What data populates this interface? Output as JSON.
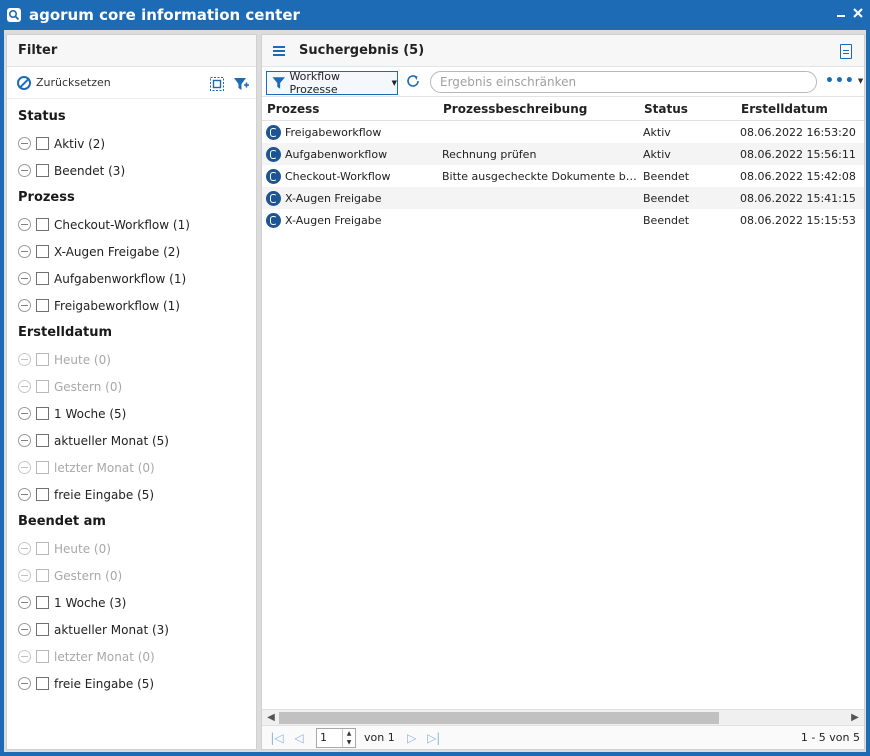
{
  "window": {
    "title": "agorum core information center"
  },
  "filter": {
    "title": "Filter",
    "reset_label": "Zurücksetzen",
    "groups": [
      {
        "title": "Status",
        "items": [
          {
            "label": "Aktiv (2)",
            "enabled": true
          },
          {
            "label": "Beendet (3)",
            "enabled": true
          }
        ]
      },
      {
        "title": "Prozess",
        "items": [
          {
            "label": "Checkout-Workflow (1)",
            "enabled": true
          },
          {
            "label": "X-Augen Freigabe (2)",
            "enabled": true
          },
          {
            "label": "Aufgabenworkflow (1)",
            "enabled": true
          },
          {
            "label": "Freigabeworkflow (1)",
            "enabled": true
          }
        ]
      },
      {
        "title": "Erstelldatum",
        "items": [
          {
            "label": "Heute (0)",
            "enabled": false
          },
          {
            "label": "Gestern (0)",
            "enabled": false
          },
          {
            "label": "1 Woche (5)",
            "enabled": true
          },
          {
            "label": "aktueller Monat (5)",
            "enabled": true
          },
          {
            "label": "letzter Monat (0)",
            "enabled": false
          },
          {
            "label": "freie Eingabe (5)",
            "enabled": true
          }
        ]
      },
      {
        "title": "Beendet am",
        "items": [
          {
            "label": "Heute (0)",
            "enabled": false
          },
          {
            "label": "Gestern (0)",
            "enabled": false
          },
          {
            "label": "1 Woche (3)",
            "enabled": true
          },
          {
            "label": "aktueller Monat (3)",
            "enabled": true
          },
          {
            "label": "letzter Monat (0)",
            "enabled": false
          },
          {
            "label": "freie Eingabe (5)",
            "enabled": true
          }
        ]
      }
    ]
  },
  "results": {
    "title": "Suchergebnis (5)",
    "workflow_button": "Workflow Prozesse",
    "search_placeholder": "Ergebnis einschränken",
    "columns": {
      "process": "Prozess",
      "description": "Prozessbeschreibung",
      "status": "Status",
      "created": "Erstelldatum"
    },
    "rows": [
      {
        "process": "Freigabeworkflow",
        "description": "",
        "status": "Aktiv",
        "created": "08.06.2022 16:53:20"
      },
      {
        "process": "Aufgabenworkflow",
        "description": "Rechnung prüfen",
        "status": "Aktiv",
        "created": "08.06.2022 15:56:11"
      },
      {
        "process": "Checkout-Workflow",
        "description": "Bitte ausgecheckte Dokumente bearb…",
        "status": "Beendet",
        "created": "08.06.2022 15:42:08"
      },
      {
        "process": "X-Augen Freigabe",
        "description": "",
        "status": "Beendet",
        "created": "08.06.2022 15:41:15"
      },
      {
        "process": "X-Augen Freigabe",
        "description": "",
        "status": "Beendet",
        "created": "08.06.2022 15:15:53"
      }
    ]
  },
  "pager": {
    "page": "1",
    "of_label": "von 1",
    "count_label": "1 - 5 von 5"
  },
  "colors": {
    "accent": "#1d6bb5",
    "disabled_text": "#a8a8a8"
  },
  "icons": {
    "titlebar": "search-icon",
    "reset": "ban-icon",
    "row": "workflow-icon"
  }
}
